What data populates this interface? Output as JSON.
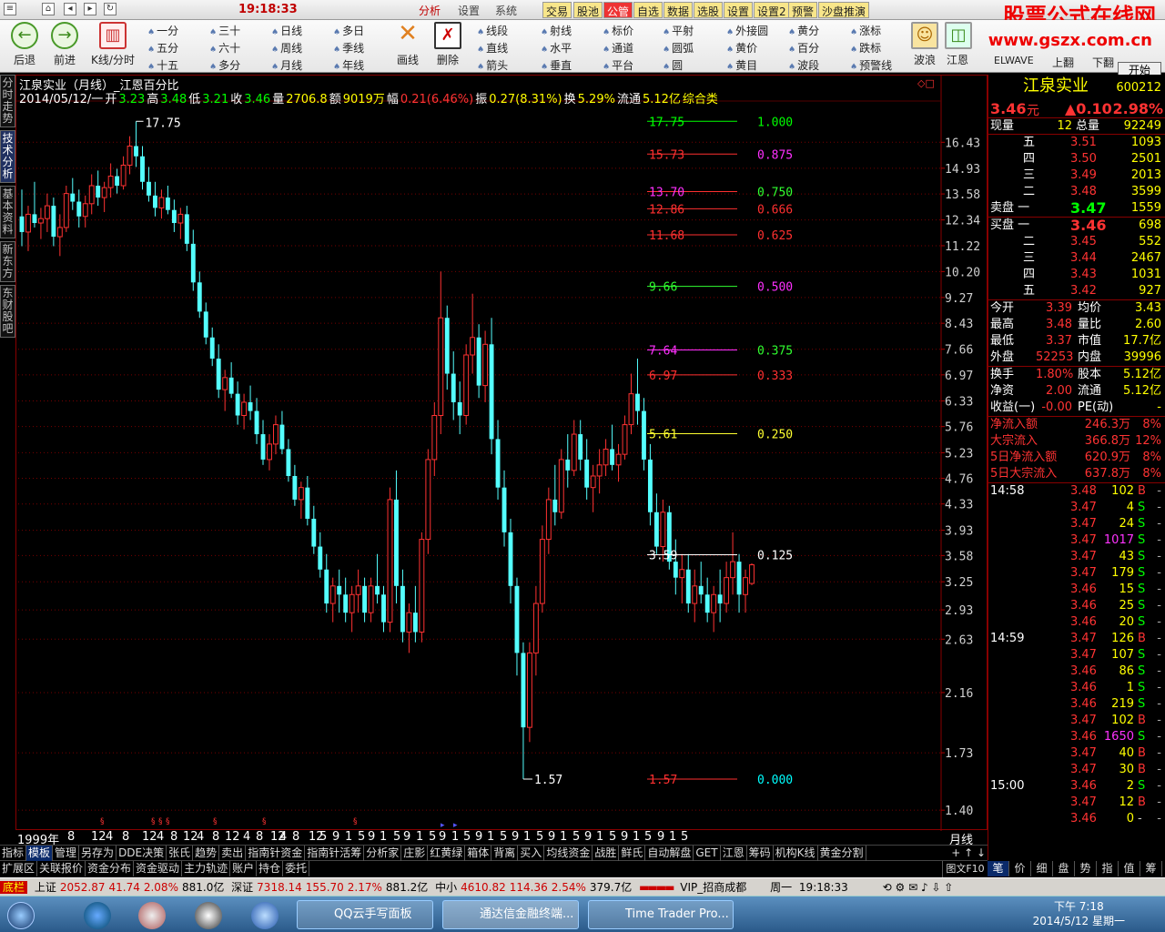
{
  "titlebar": {
    "clock": "19:18:33",
    "menus": [
      "分析",
      "设置",
      "系统"
    ],
    "buttons": [
      "交易",
      "股池",
      "公管",
      "自选",
      "数据",
      "选股",
      "设置",
      "设置2",
      "预警",
      "沙盘推演"
    ],
    "active_button": "公管",
    "win_controls": [
      "▭",
      "▭",
      "▭"
    ]
  },
  "brand": {
    "name": "股票公式在线网",
    "url": "www.gszx.com.cn"
  },
  "toolbar": {
    "back": "后退",
    "forward": "前进",
    "kline": "K线/分时",
    "periods": [
      "一分",
      "三十",
      "日线",
      "多日",
      "五分",
      "六十",
      "周线",
      "季线",
      "十五",
      "多分",
      "月线",
      "年线"
    ],
    "draw_tools": [
      "画线",
      "删除"
    ],
    "shapes": [
      "线段",
      "射线",
      "标价",
      "平射",
      "外接圆",
      "黄分",
      "涨标",
      "直线",
      "水平",
      "通道",
      "圆弧",
      "黄价",
      "百分",
      "跌标",
      "箭头",
      "垂直",
      "平台",
      "圆",
      "黄目",
      "波段",
      "预警线"
    ],
    "extra": [
      "波浪",
      "江恩",
      "ELWAVE",
      "上翻",
      "下翻"
    ],
    "start_button": "开始"
  },
  "left_tabs": [
    "分时走势",
    "技术分析",
    "基本资料",
    "新东方",
    "东财股吧"
  ],
  "active_left_tab": "技术分析",
  "chart_header": {
    "title": "江泉实业（月线）_江恩百分比",
    "date": "2014/05/12/一",
    "open_label": "开",
    "open": "3.23",
    "high_label": "高",
    "high": "3.48",
    "low_label": "低",
    "low": "3.21",
    "close_label": "收",
    "close": "3.46",
    "vol_label": "量",
    "vol": "2706.8",
    "amt_label": "额",
    "amt": "9019万",
    "chg_label": "幅",
    "chg": "0.21(6.46%)",
    "amp_label": "振",
    "amp": "0.27(8.31%)",
    "turn_label": "换",
    "turn": "5.29%",
    "float_label": "流通",
    "float": "5.12亿",
    "category": "综合类"
  },
  "chart_data": {
    "type": "candlestick",
    "title": "江泉实业（月线）_江恩百分比",
    "y_ticks": [
      16.43,
      14.93,
      13.58,
      12.34,
      11.22,
      10.2,
      9.27,
      8.43,
      7.66,
      6.97,
      6.33,
      5.76,
      5.23,
      4.76,
      4.33,
      3.93,
      3.58,
      3.25,
      2.93,
      2.63,
      2.16,
      1.73,
      1.4
    ],
    "y_tick_labels": [
      "16.43",
      "14.93",
      "13.58",
      "12.34",
      "11.22",
      "10.20",
      "9.27",
      "8.43",
      "7.66",
      "6.97",
      "6.33",
      "5.76",
      "5.23",
      "4.76",
      "4.33",
      "3.93",
      "3.58",
      "3.25",
      "2.93",
      "2.63",
      "2.16",
      "1.73",
      "1.40"
    ],
    "x_labels": [
      "1999年",
      "8",
      "12",
      "4",
      "8",
      "12",
      "4",
      "8",
      "12",
      "4",
      "8",
      "12",
      "4",
      "8",
      "12",
      "4",
      "8",
      "12",
      "5",
      "9",
      "1",
      "5",
      "9",
      "1",
      "5",
      "9",
      "1",
      "5",
      "9",
      "1",
      "5",
      "9",
      "1",
      "5",
      "9",
      "1",
      "5",
      "9",
      "1",
      "5",
      "9",
      "1",
      "5",
      "9",
      "1",
      "5",
      "9",
      "1",
      "5"
    ],
    "high_mark": "17.75",
    "low_mark": "1.57",
    "gann_levels": [
      {
        "price": "17.75",
        "pct": "1.000",
        "price_color": "#00ff00",
        "pct_color": "#00ff00",
        "line_color": "#00ff00",
        "value": 17.75
      },
      {
        "price": "15.73",
        "pct": "0.875",
        "price_color": "#ff3030",
        "pct_color": "#ff30ff",
        "line_color": "#ff3030",
        "value": 15.73
      },
      {
        "price": "13.70",
        "pct": "0.750",
        "price_color": "#ff30ff",
        "pct_color": "#30ff30",
        "line_color": "#ff3030",
        "value": 13.7
      },
      {
        "price": "12.86",
        "pct": "0.666",
        "price_color": "#ff3030",
        "pct_color": "#ff3030",
        "line_color": "#ff3030",
        "value": 12.86
      },
      {
        "price": "11.68",
        "pct": "0.625",
        "price_color": "#ff3030",
        "pct_color": "#ff3030",
        "line_color": "#ff3030",
        "value": 11.68
      },
      {
        "price": "9.66",
        "pct": "0.500",
        "price_color": "#30ff30",
        "pct_color": "#ff30ff",
        "line_color": "#30ff30",
        "value": 9.66
      },
      {
        "price": "7.64",
        "pct": "0.375",
        "price_color": "#ff30ff",
        "pct_color": "#30ff30",
        "line_color": "#ff30ff",
        "value": 7.64
      },
      {
        "price": "6.97",
        "pct": "0.333",
        "price_color": "#ff3030",
        "pct_color": "#ff3030",
        "line_color": "#ff3030",
        "value": 6.97
      },
      {
        "price": "5.61",
        "pct": "0.250",
        "price_color": "#ffff30",
        "pct_color": "#ffff30",
        "line_color": "#ffff30",
        "value": 5.61
      },
      {
        "price": "3.59",
        "pct": "0.125",
        "price_color": "#ffffff",
        "pct_color": "#ffffff",
        "line_color": "#ffffff",
        "value": 3.59
      },
      {
        "price": "1.57",
        "pct": "0.000",
        "price_color": "#ff3030",
        "pct_color": "#00ffff",
        "line_color": "#ff3030",
        "value": 1.57
      }
    ],
    "ohlc": [
      [
        12.5,
        13.8,
        11.2,
        11.8
      ],
      [
        11.8,
        13.0,
        11.0,
        12.6
      ],
      [
        12.6,
        14.2,
        12.0,
        12.2
      ],
      [
        12.2,
        12.9,
        11.5,
        12.4
      ],
      [
        12.4,
        13.6,
        11.8,
        13.0
      ],
      [
        13.0,
        13.4,
        11.2,
        11.6
      ],
      [
        11.6,
        12.6,
        10.8,
        12.0
      ],
      [
        12.0,
        14.0,
        11.8,
        13.6
      ],
      [
        13.6,
        14.4,
        12.8,
        13.2
      ],
      [
        13.2,
        13.8,
        12.0,
        12.5
      ],
      [
        12.5,
        13.5,
        12.0,
        13.1
      ],
      [
        13.1,
        14.6,
        12.6,
        14.0
      ],
      [
        14.0,
        14.8,
        13.0,
        13.4
      ],
      [
        13.4,
        14.2,
        12.7,
        13.9
      ],
      [
        13.9,
        15.2,
        13.4,
        14.5
      ],
      [
        14.5,
        14.9,
        13.6,
        14.0
      ],
      [
        14.0,
        15.6,
        13.8,
        15.1
      ],
      [
        15.1,
        16.8,
        14.6,
        16.2
      ],
      [
        16.2,
        17.75,
        15.0,
        15.6
      ],
      [
        15.6,
        16.2,
        13.8,
        14.2
      ],
      [
        14.2,
        15.0,
        13.2,
        13.5
      ],
      [
        13.5,
        14.2,
        12.5,
        12.9
      ],
      [
        12.9,
        13.8,
        12.4,
        13.4
      ],
      [
        13.4,
        14.0,
        12.6,
        12.8
      ],
      [
        12.8,
        13.3,
        11.8,
        12.2
      ],
      [
        12.2,
        12.9,
        11.5,
        12.6
      ],
      [
        12.6,
        13.0,
        11.0,
        11.3
      ],
      [
        11.3,
        11.9,
        9.5,
        9.8
      ],
      [
        9.8,
        10.2,
        8.6,
        8.8
      ],
      [
        8.8,
        9.1,
        7.8,
        8.0
      ],
      [
        8.0,
        8.3,
        7.2,
        7.4
      ],
      [
        7.4,
        7.8,
        6.4,
        6.6
      ],
      [
        6.6,
        7.1,
        6.1,
        6.9
      ],
      [
        6.9,
        7.3,
        6.4,
        6.5
      ],
      [
        6.5,
        6.8,
        5.8,
        6.0
      ],
      [
        6.0,
        6.5,
        5.7,
        6.3
      ],
      [
        6.3,
        6.7,
        5.9,
        6.1
      ],
      [
        6.1,
        6.4,
        5.4,
        5.6
      ],
      [
        5.6,
        5.9,
        5.0,
        5.1
      ],
      [
        5.1,
        5.6,
        4.9,
        5.4
      ],
      [
        5.4,
        6.0,
        5.2,
        5.8
      ],
      [
        5.8,
        6.1,
        5.2,
        5.3
      ],
      [
        5.3,
        5.5,
        4.7,
        4.8
      ],
      [
        4.8,
        5.0,
        4.3,
        4.4
      ],
      [
        4.4,
        4.7,
        4.1,
        4.6
      ],
      [
        4.6,
        4.8,
        4.0,
        4.1
      ],
      [
        4.1,
        4.3,
        3.6,
        3.7
      ],
      [
        3.7,
        3.9,
        3.3,
        3.4
      ],
      [
        3.4,
        3.6,
        2.9,
        3.0
      ],
      [
        3.0,
        3.3,
        2.8,
        3.2
      ],
      [
        3.2,
        3.4,
        2.9,
        3.1
      ],
      [
        3.1,
        3.3,
        2.8,
        2.9
      ],
      [
        2.9,
        3.2,
        2.7,
        3.1
      ],
      [
        3.1,
        3.4,
        2.9,
        3.2
      ],
      [
        3.2,
        3.3,
        2.8,
        2.9
      ],
      [
        2.9,
        3.3,
        2.8,
        3.2
      ],
      [
        3.2,
        3.6,
        3.0,
        3.1
      ],
      [
        3.1,
        3.2,
        2.7,
        2.8
      ],
      [
        2.8,
        4.6,
        2.7,
        4.4
      ],
      [
        4.4,
        4.9,
        3.0,
        3.2
      ],
      [
        3.2,
        3.4,
        2.6,
        2.7
      ],
      [
        2.7,
        3.0,
        2.5,
        2.9
      ],
      [
        2.9,
        3.2,
        2.6,
        2.7
      ],
      [
        2.7,
        3.9,
        2.6,
        3.8
      ],
      [
        3.8,
        5.3,
        3.6,
        5.1
      ],
      [
        5.1,
        6.3,
        4.8,
        6.0
      ],
      [
        6.0,
        10.2,
        5.6,
        8.6
      ],
      [
        8.6,
        9.0,
        6.6,
        7.0
      ],
      [
        7.0,
        7.6,
        5.9,
        6.3
      ],
      [
        6.3,
        6.8,
        5.6,
        6.0
      ],
      [
        6.0,
        7.8,
        5.8,
        7.5
      ],
      [
        7.5,
        9.4,
        7.0,
        8.0
      ],
      [
        8.0,
        8.4,
        6.4,
        6.7
      ],
      [
        6.7,
        8.2,
        6.3,
        7.8
      ],
      [
        7.8,
        8.6,
        5.2,
        5.5
      ],
      [
        5.5,
        5.9,
        4.4,
        4.6
      ],
      [
        4.6,
        4.9,
        3.7,
        3.9
      ],
      [
        3.9,
        4.1,
        3.0,
        3.2
      ],
      [
        3.2,
        3.3,
        2.3,
        2.5
      ],
      [
        2.5,
        2.6,
        1.57,
        1.9
      ],
      [
        1.9,
        2.6,
        1.8,
        2.5
      ],
      [
        2.5,
        3.2,
        2.3,
        3.0
      ],
      [
        3.0,
        4.0,
        2.9,
        3.8
      ],
      [
        3.8,
        4.6,
        3.6,
        4.4
      ],
      [
        4.4,
        5.0,
        4.0,
        4.2
      ],
      [
        4.2,
        5.3,
        4.1,
        5.1
      ],
      [
        5.1,
        5.6,
        4.6,
        4.9
      ],
      [
        4.9,
        5.9,
        4.8,
        5.6
      ],
      [
        5.6,
        5.9,
        4.9,
        5.1
      ],
      [
        5.1,
        5.5,
        4.4,
        4.6
      ],
      [
        4.6,
        5.0,
        4.2,
        4.8
      ],
      [
        4.8,
        5.3,
        4.5,
        5.0
      ],
      [
        5.0,
        5.5,
        4.8,
        5.3
      ],
      [
        5.3,
        5.8,
        4.9,
        5.0
      ],
      [
        5.0,
        5.4,
        4.7,
        5.2
      ],
      [
        5.2,
        6.0,
        5.1,
        5.8
      ],
      [
        5.8,
        7.0,
        5.6,
        6.5
      ],
      [
        6.5,
        7.4,
        5.8,
        6.1
      ],
      [
        6.1,
        6.4,
        4.9,
        5.1
      ],
      [
        5.1,
        5.4,
        4.0,
        4.2
      ],
      [
        4.2,
        4.5,
        3.6,
        3.7
      ],
      [
        3.7,
        4.4,
        3.5,
        4.2
      ],
      [
        4.2,
        4.3,
        3.4,
        3.5
      ],
      [
        3.5,
        3.8,
        3.1,
        3.3
      ],
      [
        3.3,
        3.6,
        3.0,
        3.4
      ],
      [
        3.4,
        3.6,
        2.9,
        3.0
      ],
      [
        3.0,
        3.4,
        2.8,
        3.2
      ],
      [
        3.2,
        3.5,
        3.0,
        3.1
      ],
      [
        3.1,
        3.3,
        2.8,
        2.9
      ],
      [
        2.9,
        3.2,
        2.7,
        3.1
      ],
      [
        3.1,
        3.4,
        2.8,
        3.0
      ],
      [
        3.0,
        3.5,
        2.9,
        3.3
      ],
      [
        3.3,
        3.9,
        3.1,
        3.5
      ],
      [
        3.5,
        3.6,
        2.9,
        3.1
      ],
      [
        3.1,
        3.4,
        2.9,
        3.3
      ],
      [
        3.23,
        3.48,
        3.21,
        3.46
      ]
    ]
  },
  "datebar": {
    "right_label": "月线"
  },
  "bottom_tabs": [
    "指标",
    "模板",
    "管理",
    "另存为",
    "DDE决策",
    "张氏",
    "趋势",
    "卖出",
    "指南针资金",
    "指南针活筹",
    "分析家",
    "庄影",
    "红黄绿",
    "箱体",
    "背离",
    "买入",
    "均线资金",
    "战胜",
    "鲜氏",
    "自动解盘",
    "GET",
    "江恩",
    "筹码",
    "机构K线",
    "黄金分割"
  ],
  "active_bottom_tab": "模板",
  "sub_tabs": [
    "扩展区",
    "关联报价",
    "资金分布",
    "资金驱动",
    "主力轨迹",
    "账户",
    "持仓",
    "委托"
  ],
  "stock": {
    "name": "江泉实业",
    "code": "600212",
    "price": "3.46",
    "price_unit": "元",
    "change": "▲0.10",
    "change_pct": "2.98%"
  },
  "quote_summary": {
    "now_hand_label": "现量",
    "now_hand": "12",
    "total_label": "总量",
    "total": "92249"
  },
  "asks": [
    {
      "label": "五",
      "price": "3.51",
      "vol": "1093"
    },
    {
      "label": "四",
      "price": "3.50",
      "vol": "2501"
    },
    {
      "label": "三",
      "price": "3.49",
      "vol": "2013"
    },
    {
      "label": "二",
      "price": "3.48",
      "vol": "3599"
    },
    {
      "label": "卖盘 一",
      "price": "3.47",
      "vol": "1559"
    }
  ],
  "bids": [
    {
      "label": "买盘 一",
      "price": "3.46",
      "vol": "698"
    },
    {
      "label": "二",
      "price": "3.45",
      "vol": "552"
    },
    {
      "label": "三",
      "price": "3.44",
      "vol": "2467"
    },
    {
      "label": "四",
      "price": "3.43",
      "vol": "1031"
    },
    {
      "label": "五",
      "price": "3.42",
      "vol": "927"
    }
  ],
  "stats": [
    {
      "l1": "今开",
      "v1": "3.39",
      "l2": "均价",
      "v2": "3.43"
    },
    {
      "l1": "最高",
      "v1": "3.48",
      "l2": "量比",
      "v2": "2.60"
    },
    {
      "l1": "最低",
      "v1": "3.37",
      "l2": "市值",
      "v2": "17.7亿"
    },
    {
      "l1": "外盘",
      "v1": "52253",
      "l2": "内盘",
      "v2": "39996"
    }
  ],
  "stats2": [
    {
      "l1": "换手",
      "v1": "1.80%",
      "l2": "股本",
      "v2": "5.12亿"
    },
    {
      "l1": "净资",
      "v1": "2.00",
      "l2": "流通",
      "v2": "5.12亿"
    },
    {
      "l1": "收益(一)",
      "v1": "-0.00",
      "l2": "PE(动)",
      "v2": "-"
    }
  ],
  "flows": [
    {
      "label": "净流入额",
      "value": "246.3万",
      "pct": "8%"
    },
    {
      "label": "大宗流入",
      "value": "366.8万",
      "pct": "12%"
    },
    {
      "label": "5日净流入额",
      "value": "620.9万",
      "pct": "8%"
    },
    {
      "label": "5日大宗流入",
      "value": "637.8万",
      "pct": "8%"
    }
  ],
  "ticks": [
    {
      "time": "14:58",
      "price": "3.48",
      "vol": "102",
      "side": "B"
    },
    {
      "time": "",
      "price": "3.47",
      "vol": "4",
      "side": "S"
    },
    {
      "time": "",
      "price": "3.47",
      "vol": "24",
      "side": "S"
    },
    {
      "time": "",
      "price": "3.47",
      "vol": "1017",
      "side": "S"
    },
    {
      "time": "",
      "price": "3.47",
      "vol": "43",
      "side": "S"
    },
    {
      "time": "",
      "price": "3.47",
      "vol": "179",
      "side": "S"
    },
    {
      "time": "",
      "price": "3.46",
      "vol": "15",
      "side": "S"
    },
    {
      "time": "",
      "price": "3.46",
      "vol": "25",
      "side": "S"
    },
    {
      "time": "",
      "price": "3.46",
      "vol": "20",
      "side": "S"
    },
    {
      "time": "14:59",
      "price": "3.47",
      "vol": "126",
      "side": "B"
    },
    {
      "time": "",
      "price": "3.47",
      "vol": "107",
      "side": "S"
    },
    {
      "time": "",
      "price": "3.46",
      "vol": "86",
      "side": "S"
    },
    {
      "time": "",
      "price": "3.46",
      "vol": "1",
      "side": "S"
    },
    {
      "time": "",
      "price": "3.46",
      "vol": "219",
      "side": "S"
    },
    {
      "time": "",
      "price": "3.47",
      "vol": "102",
      "side": "B"
    },
    {
      "time": "",
      "price": "3.46",
      "vol": "1650",
      "side": "S"
    },
    {
      "time": "",
      "price": "3.47",
      "vol": "40",
      "side": "B"
    },
    {
      "time": "",
      "price": "3.47",
      "vol": "30",
      "side": "B"
    },
    {
      "time": "15:00",
      "price": "3.46",
      "vol": "2",
      "side": "S"
    },
    {
      "time": "",
      "price": "3.47",
      "vol": "12",
      "side": "B"
    },
    {
      "time": "",
      "price": "3.46",
      "vol": "0",
      "side": "-"
    }
  ],
  "rp_tabs": [
    "笔",
    "价",
    "细",
    "盘",
    "势",
    "指",
    "值",
    "筹"
  ],
  "status": {
    "menu": "底栏",
    "sh_label": "上证",
    "sh": "2052.87",
    "sh_chg": "41.74",
    "sh_pct": "2.08%",
    "sh_amt": "881.0亿",
    "sz_label": "深证",
    "sz": "7318.14",
    "sz_chg": "155.70",
    "sz_pct": "2.17%",
    "sz_amt": "881.2亿",
    "sm_label": "中小",
    "sm": "4610.82",
    "sm_chg": "114.36",
    "sm_pct": "2.54%",
    "sm_amt": "379.7亿",
    "vip": "VIP_招商成都",
    "weekday": "周一",
    "time": "19:18:33",
    "chart_tag": "图文F10"
  },
  "taskbar": {
    "tasks": [
      "QQ云手写面板",
      "通达信金融终端...",
      "Time Trader Pro..."
    ],
    "time": "下午 7:18",
    "date": "2014/5/12 星期一"
  }
}
